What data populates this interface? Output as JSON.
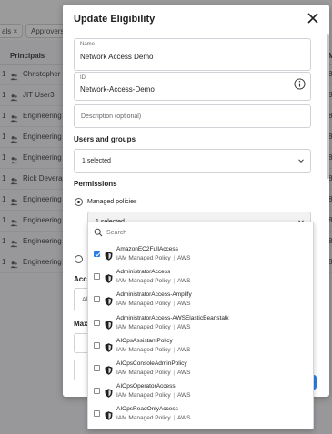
{
  "background": {
    "chips": [
      "als ×",
      "Approvers"
    ],
    "header": {
      "principals": "Principals",
      "right": "M"
    },
    "rows": [
      {
        "num": "1",
        "name": "Christopher Ed",
        "right": "8"
      },
      {
        "num": "1",
        "name": "JIT User3",
        "right": "8"
      },
      {
        "num": "1",
        "name": "Engineering",
        "right": "8"
      },
      {
        "num": "1",
        "name": "Engineering",
        "right": "8"
      },
      {
        "num": "1",
        "name": "Engineering",
        "right": "8"
      },
      {
        "num": "1",
        "name": "Rick Devera Re",
        "right": "8"
      },
      {
        "num": "1",
        "name": "Engineering",
        "right": "8"
      },
      {
        "num": "1",
        "name": "Engineering",
        "right": "8"
      },
      {
        "num": "1",
        "name": "Engineering",
        "right": "8"
      },
      {
        "num": "1",
        "name": "Engineering",
        "right": "8"
      }
    ]
  },
  "modal": {
    "title": "Update Eligibility",
    "name_field": {
      "label": "Name",
      "value": "Network Access Demo"
    },
    "id_field": {
      "label": "ID",
      "value": "Network-Access-Demo"
    },
    "description_field": {
      "placeholder": "Description (optional)"
    },
    "users_groups": {
      "title": "Users and groups",
      "value": "1 selected"
    },
    "permissions": {
      "title": "Permissions",
      "managed_label": "Managed policies",
      "managed_value": "1 selected"
    },
    "partial_labels": {
      "acc": "Acc",
      "al": "Al",
      "max": "Max"
    }
  },
  "dropdown": {
    "search_placeholder": "Search",
    "options": [
      {
        "name": "AmazonEC2FullAccess",
        "type": "IAM Managed Policy",
        "provider": "AWS",
        "checked": true
      },
      {
        "name": "AdministratorAccess",
        "type": "IAM Managed Policy",
        "provider": "AWS",
        "checked": false
      },
      {
        "name": "AdministratorAccess-Amplify",
        "type": "IAM Managed Policy",
        "provider": "AWS",
        "checked": false
      },
      {
        "name": "AdministratorAccess-AWSElasticBeanstalk",
        "type": "IAM Managed Policy",
        "provider": "AWS",
        "checked": false
      },
      {
        "name": "AIOpsAssistantPolicy",
        "type": "IAM Managed Policy",
        "provider": "AWS",
        "checked": false
      },
      {
        "name": "AIOpsConsoleAdminPolicy",
        "type": "IAM Managed Policy",
        "provider": "AWS",
        "checked": false
      },
      {
        "name": "AIOpsOperatorAccess",
        "type": "IAM Managed Policy",
        "provider": "AWS",
        "checked": false
      },
      {
        "name": "AIOpsReadOnlyAccess",
        "type": "IAM Managed Policy",
        "provider": "AWS",
        "checked": false
      }
    ]
  },
  "colors": {
    "accent": "#2b7de9",
    "overlay": "#282828"
  }
}
